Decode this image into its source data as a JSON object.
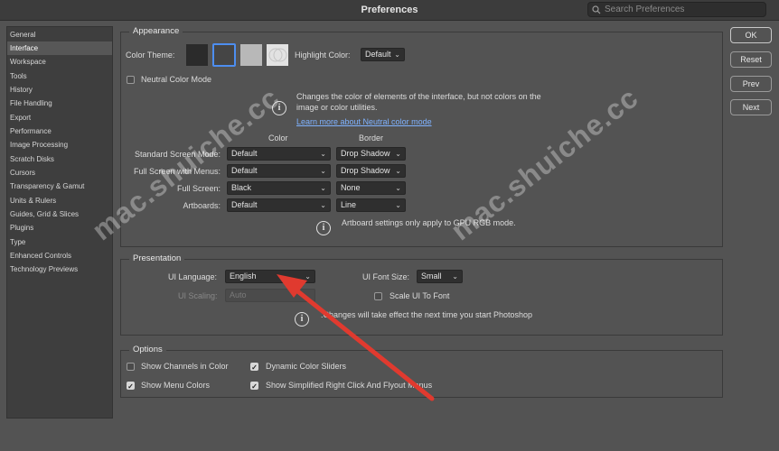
{
  "window": {
    "title": "Preferences",
    "search_placeholder": "Search Preferences"
  },
  "sidebar": {
    "items": [
      {
        "label": "General"
      },
      {
        "label": "Interface"
      },
      {
        "label": "Workspace"
      },
      {
        "label": "Tools"
      },
      {
        "label": "History"
      },
      {
        "label": "File Handling"
      },
      {
        "label": "Export"
      },
      {
        "label": "Performance"
      },
      {
        "label": "Image Processing"
      },
      {
        "label": "Scratch Disks"
      },
      {
        "label": "Cursors"
      },
      {
        "label": "Transparency & Gamut"
      },
      {
        "label": "Units & Rulers"
      },
      {
        "label": "Guides, Grid & Slices"
      },
      {
        "label": "Plugins"
      },
      {
        "label": "Type"
      },
      {
        "label": "Enhanced Controls"
      },
      {
        "label": "Technology Previews"
      }
    ],
    "selected": "Interface"
  },
  "appearance": {
    "title": "Appearance",
    "color_theme_label": "Color Theme:",
    "swatch_colors": [
      "#2b2b2b",
      "#454545",
      "#b8b8b8",
      "#e2e2e2"
    ],
    "highlight_label": "Highlight Color:",
    "highlight_value": "Default",
    "neutral_label": "Neutral Color Mode",
    "neutral_info_line1": "Changes the color of elements of the interface, but not colors on the",
    "neutral_info_line2": "image or color utilities.",
    "learn_more": "Learn more about Neutral color mode",
    "col_color": "Color",
    "col_border": "Border",
    "rows": [
      {
        "label": "Standard Screen Mode:",
        "color": "Default",
        "border": "Drop Shadow"
      },
      {
        "label": "Full Screen with Menus:",
        "color": "Default",
        "border": "Drop Shadow"
      },
      {
        "label": "Full Screen:",
        "color": "Black",
        "border": "None"
      },
      {
        "label": "Artboards:",
        "color": "Default",
        "border": "Line"
      }
    ],
    "artboard_note": "Artboard settings only apply to GPU RGB mode."
  },
  "presentation": {
    "title": "Presentation",
    "ui_language_label": "UI Language:",
    "ui_language_value": "English",
    "ui_font_size_label": "UI Font Size:",
    "ui_font_size_value": "Small",
    "ui_scaling_label": "UI Scaling:",
    "ui_scaling_value": "Auto",
    "scale_font_label": "Scale UI To Font",
    "note": "Changes will take effect the next time you start Photoshop."
  },
  "options": {
    "title": "Options",
    "show_channels": "Show Channels in Color",
    "dynamic_sliders": "Dynamic Color Sliders",
    "show_menu_colors": "Show Menu Colors",
    "simplified_menus": "Show Simplified Right Click And Flyout Menus"
  },
  "buttons": {
    "ok": "OK",
    "reset": "Reset",
    "prev": "Prev",
    "next": "Next"
  },
  "watermark": "mac.shuiche.cc",
  "annotation_color": "#e03a2f"
}
